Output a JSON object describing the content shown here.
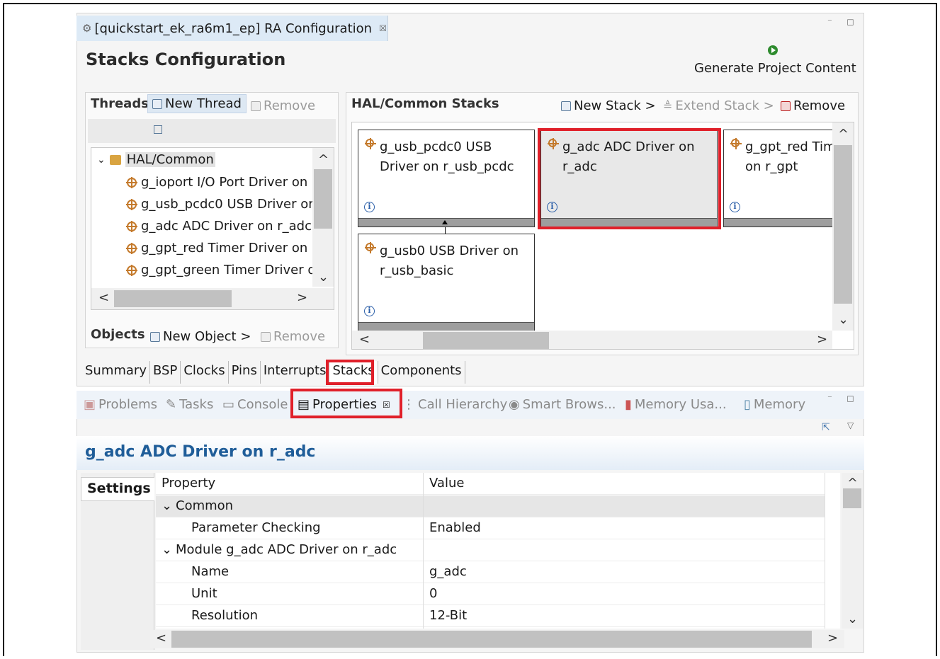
{
  "editor": {
    "tab_title": "[quickstart_ek_ra6m1_ep] RA Configuration",
    "tab_close": "☒",
    "window_buttons": "⁻ ◻",
    "page_title": "Stacks Configuration",
    "generate_label": "Generate Project Content"
  },
  "threads": {
    "heading": "Threads",
    "new_thread": "New Thread",
    "remove": "Remove",
    "tree": [
      {
        "label": "HAL/Common",
        "expanded_glyph": "⌄"
      },
      {
        "label": "g_ioport I/O Port Driver on"
      },
      {
        "label": "g_usb_pcdc0 USB Driver or"
      },
      {
        "label": "g_adc ADC Driver on r_adc"
      },
      {
        "label": "g_gpt_red Timer Driver on r"
      },
      {
        "label": "g_gpt_green Timer Driver o"
      }
    ]
  },
  "objects": {
    "heading": "Objects",
    "new_object": "New Object >",
    "remove": "Remove"
  },
  "hal_stacks": {
    "heading": "HAL/Common Stacks",
    "new_stack": "New Stack >",
    "extend_stack": "Extend Stack >",
    "remove": "Remove",
    "blocks": [
      {
        "line1": "g_usb_pcdc0 USB",
        "line2": "Driver on r_usb_pcdc"
      },
      {
        "line1": "g_adc ADC Driver on",
        "line2": "r_adc"
      },
      {
        "line1": "g_gpt_red Tim",
        "line2": "on r_gpt"
      },
      {
        "line1": "g_usb0 USB Driver on",
        "line2": "r_usb_basic"
      }
    ],
    "info_glyph": "i"
  },
  "config_tabs": [
    "Summary",
    "BSP",
    "Clocks",
    "Pins",
    "Interrupts",
    "Stacks",
    "Components"
  ],
  "view_tabs": [
    {
      "label": "Problems"
    },
    {
      "label": "Tasks"
    },
    {
      "label": "Console"
    },
    {
      "label": "Properties"
    },
    {
      "label": "Call Hierarchy"
    },
    {
      "label": "Smart Brows..."
    },
    {
      "label": "Memory Usa..."
    },
    {
      "label": "Memory"
    }
  ],
  "properties": {
    "title": "g_adc ADC Driver on r_adc",
    "settings_tab": "Settings",
    "col_property": "Property",
    "col_value": "Value",
    "rows": [
      {
        "property": "Common",
        "value": "",
        "group": true
      },
      {
        "property": "Parameter Checking",
        "value": "Enabled"
      },
      {
        "property": "Module g_adc ADC Driver on r_adc",
        "value": "",
        "group": true
      },
      {
        "property": "Name",
        "value": "g_adc"
      },
      {
        "property": "Unit",
        "value": "0"
      },
      {
        "property": "Resolution",
        "value": "12-Bit"
      }
    ]
  },
  "colors": {
    "highlight": "#e0202a",
    "title_blue": "#1f5d99"
  }
}
